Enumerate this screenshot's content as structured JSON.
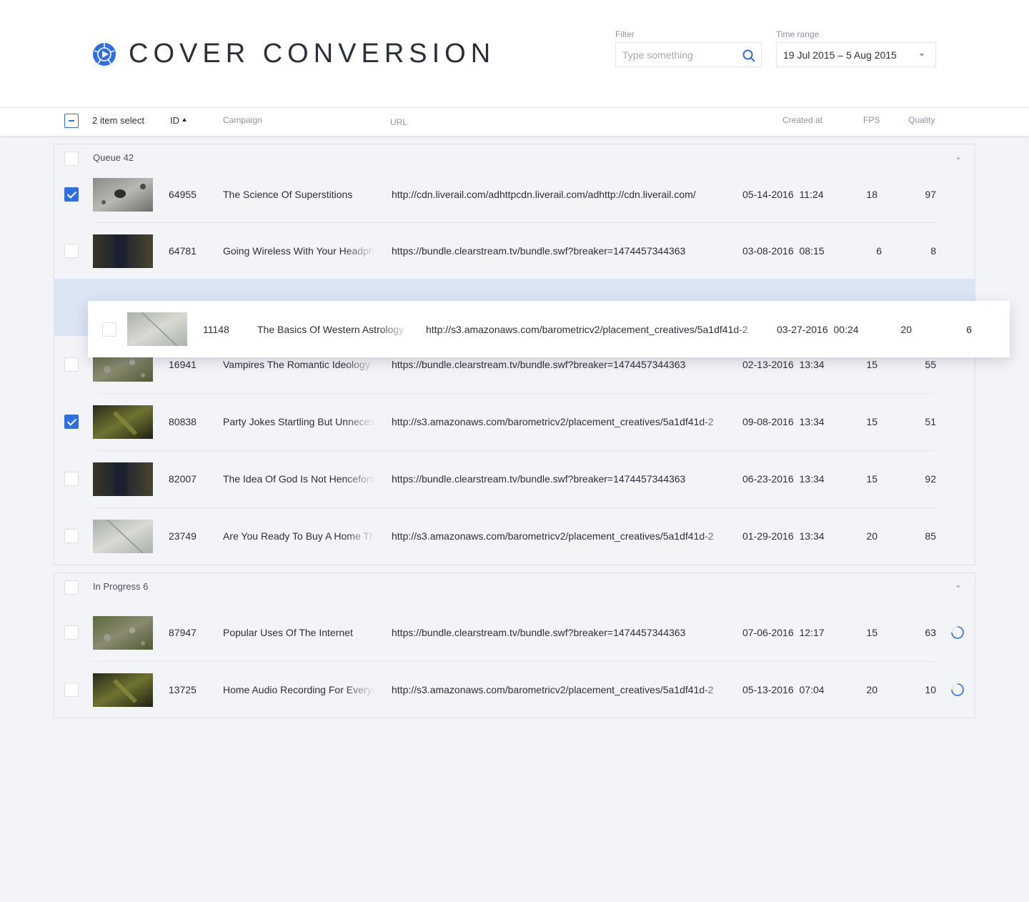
{
  "app": {
    "title": "COVER CONVERSION",
    "brand_color": "#2f6fdf"
  },
  "filter": {
    "label": "Filter",
    "placeholder": "Type something",
    "value": ""
  },
  "time_range": {
    "label": "Time range",
    "value": "19 Jul 2015 – 5 Aug 2015"
  },
  "header": {
    "selection_text": "2 item select",
    "columns": {
      "id": "ID",
      "campaign": "Campaign",
      "url": "URL",
      "created_at": "Created at",
      "fps": "FPS",
      "quality": "Quality"
    }
  },
  "groups": [
    {
      "label": "Queue 42",
      "expanded": true,
      "rows": [
        {
          "checked": true,
          "thumbnail": "rocky-crater",
          "id": "64955",
          "campaign": "The Science Of Superstitions",
          "url": "http://cdn.liverail.com/adhttpcdn.liverail.com/adhttp://cdn.liverail.com/",
          "created_at": "05-14-2016  11:24",
          "fps": "18",
          "quality": "97"
        },
        {
          "checked": false,
          "thumbnail": "dark-landscape",
          "id": "64781",
          "campaign": "Going Wireless With Your Headphones",
          "url": "https://bundle.clearstream.tv/bundle.swf?breaker=1474457344363",
          "created_at": "03-08-2016  08:15",
          "fps": "6",
          "quality": "8"
        },
        {
          "checked": false,
          "thumbnail": "mossy-rocks",
          "id": "16941",
          "campaign": "Vampires The Romantic Ideology",
          "url": "https://bundle.clearstream.tv/bundle.swf?breaker=1474457344363",
          "created_at": "02-13-2016  13:34",
          "fps": "15",
          "quality": "55"
        },
        {
          "checked": true,
          "thumbnail": "green-foliage",
          "id": "80838",
          "campaign": "Party Jokes Startling But Unnecessary",
          "url": "http://s3.amazonaws.com/barometricv2/placement_creatives/5a1df41d-2",
          "created_at": "09-08-2016  13:34",
          "fps": "15",
          "quality": "51"
        },
        {
          "checked": false,
          "thumbnail": "dark-landscape",
          "id": "82007",
          "campaign": "The Idea Of God Is Not Henceforth",
          "url": "https://bundle.clearstream.tv/bundle.swf?breaker=1474457344363",
          "created_at": "06-23-2016  13:34",
          "fps": "15",
          "quality": "92"
        },
        {
          "checked": false,
          "thumbnail": "pale-stone",
          "id": "23749",
          "campaign": "Are You Ready To Buy A Home That",
          "url": "http://s3.amazonaws.com/barometricv2/placement_creatives/5a1df41d-2",
          "created_at": "01-29-2016  13:34",
          "fps": "20",
          "quality": "85"
        }
      ]
    },
    {
      "label": "In Progress 6",
      "expanded": false,
      "rows": [
        {
          "checked": false,
          "thumbnail": "mossy-rocks",
          "id": "87947",
          "campaign": "Popular Uses Of The Internet",
          "url": "https://bundle.clearstream.tv/bundle.swf?breaker=1474457344363",
          "created_at": "07-06-2016  12:17",
          "fps": "15",
          "quality": "63",
          "status_icon": "spinner-icon"
        },
        {
          "checked": false,
          "thumbnail": "green-foliage",
          "id": "13725",
          "campaign": "Home Audio Recording For Everyone",
          "url": "http://s3.amazonaws.com/barometricv2/placement_creatives/5a1df41d-2",
          "created_at": "05-13-2016  07:04",
          "fps": "20",
          "quality": "10",
          "status_icon": "spinner-icon"
        }
      ]
    }
  ],
  "dragging_row": {
    "checked": false,
    "thumbnail": "pale-stone",
    "id": "11148",
    "campaign": "The Basics Of Western Astrology",
    "url": "http://s3.amazonaws.com/barometricv2/placement_creatives/5a1df41d-2",
    "created_at": "03-27-2016  00:24",
    "fps": "20",
    "quality": "6"
  }
}
